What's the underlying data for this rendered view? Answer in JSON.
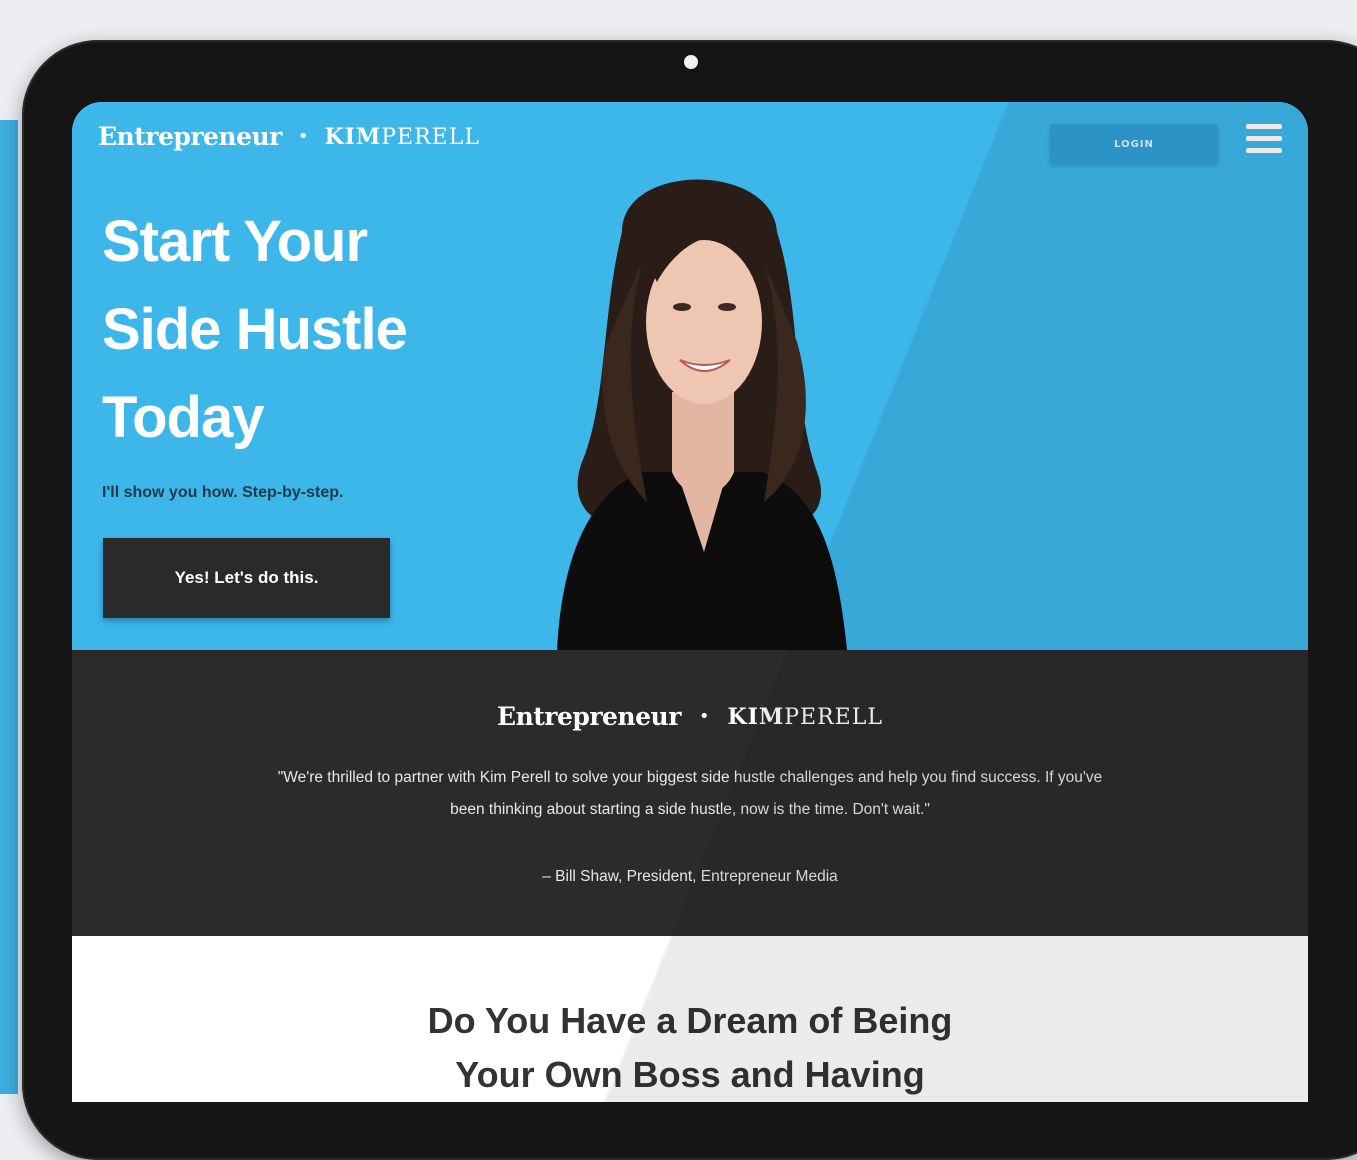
{
  "header": {
    "brand_entrepreneur": "Entrepreneur",
    "brand_separator": "•",
    "brand_kim_bold": "KIM",
    "brand_kim_rest": "PERELL",
    "login_label": "LOGIN"
  },
  "hero": {
    "title_lines": [
      "Start Your",
      "Side Hustle",
      "Today"
    ],
    "subtitle": "I'll show you how. Step-by-step.",
    "cta_label": "Yes! Let's do this."
  },
  "testimonial": {
    "brand_entrepreneur": "Entrepreneur",
    "brand_separator": "•",
    "brand_kim_bold": "KIM",
    "brand_kim_rest": "PERELL",
    "quote": "\"We're thrilled to partner with Kim Perell to solve your biggest side hustle challenges and help you find success. If you've been thinking about starting a side hustle, now is the time. Don't wait.\"",
    "attribution": "– Bill Shaw, President, Entrepreneur Media"
  },
  "section": {
    "title_lines": [
      "Do You Have a Dream of Being",
      "Your Own Boss and Having"
    ]
  },
  "colors": {
    "hero_bg": "#3db6ea",
    "band_bg": "#2b2b2b",
    "cta_bg": "#2a2a2a",
    "login_bg": "#2f9fd6"
  },
  "icons": [
    "hamburger-menu-icon",
    "camera-dot-icon"
  ]
}
